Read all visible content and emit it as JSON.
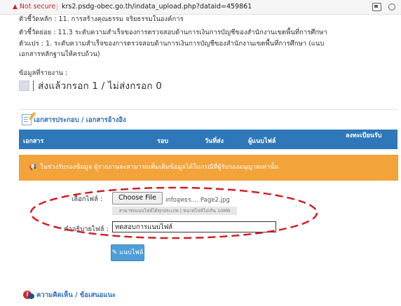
{
  "browser": {
    "security_label": "Not secure",
    "url": "krs2.psdg-obec.go.th/indata_upload.php?dataid=459861"
  },
  "indicator": {
    "main": "ตัวชี้วัดหลัก : 11. การสร้างคุณธรรม จริยธรรมในองค์การ",
    "sub": "ตัวชี้วัดย่อย : 11.3 ระดับความสำเร็จของการตรวจสอบด้านการเงินการบัญชีของสำนักงานเขตพื้นที่การศึกษา",
    "variable_line1": "ตัวแปร : 1. ระดับความสำเร็จของการตรวจสอบด้านการเงินการบัญชีของสำนักงานเขตพื้นที่การศึกษา (แนบ",
    "variable_line2": "เอกสารหลักฐานให้ครบถ้วน)"
  },
  "report": {
    "label": "ข้อมูลที่รายงาน :",
    "status": "ส่งแล้วกรอก 1 / ไม่ส่งกรอก 0"
  },
  "documents": {
    "title": "เอกสารประกอบ / เอกสารอ้างอิง",
    "columns": [
      "เอกสาร",
      "รอบ",
      "วันที่ส่ง",
      "ผู้แนบไฟล์",
      "ลงทะเบียนรับ"
    ]
  },
  "notice": {
    "icon": "megaphone-icon",
    "text": "ในช่วงรับรองข้อมูล ผู้รายงานจะสามารถเพิ่มเติมข้อมูลได้ในกรณีที่ผู้รับรองอนุญาตเท่านั้น"
  },
  "upload_form": {
    "file_label": "เลือกไฟล์ :",
    "choose_button": "Choose File",
    "file_name": "infoอุทธร.... Page2.jpg",
    "hint": "สามารถแนบไฟล์ได้ทุกประเภท | ขนาดไฟล์ไม่เกิน 10MB",
    "description_label": "คำอธิบายไฟล์ :",
    "description_value": "ทดสอบการแนบไฟล์",
    "submit_label": "แนบไฟล์"
  },
  "comments": {
    "title": "ความคิดเห็น / ข้อเสนอแนะ"
  },
  "colors": {
    "table_header": "#2e78ba",
    "notice": "#f2a33a",
    "button": "#4e9fd8",
    "annotation": "#d21f26",
    "link": "#2f6fb5"
  }
}
